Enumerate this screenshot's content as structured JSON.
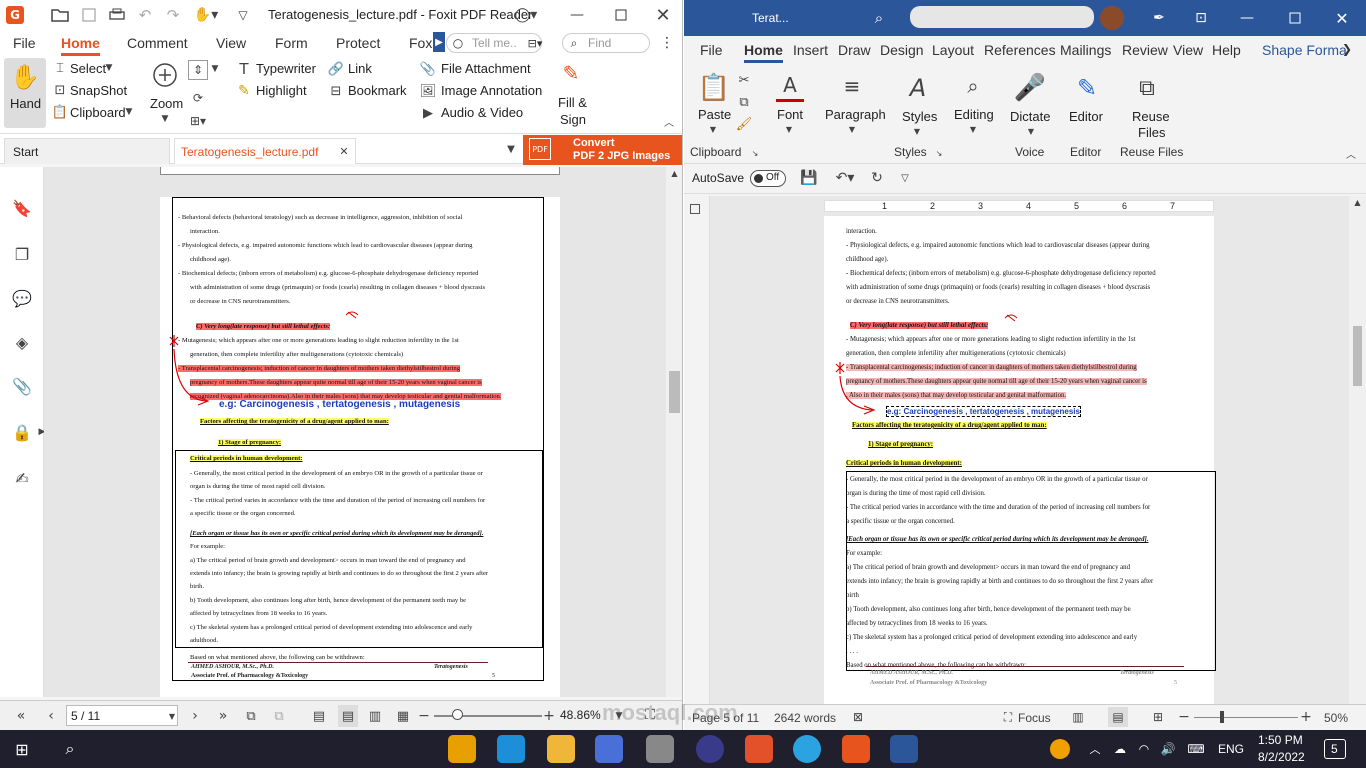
{
  "foxit": {
    "title": "Teratogenesis_lecture.pdf - Foxit PDF Reader",
    "menu": [
      "File",
      "Home",
      "Comment",
      "View",
      "Form",
      "Protect",
      "Foxi"
    ],
    "search": {
      "tell_me": "Tell me..",
      "find": "Find"
    },
    "ribbon": {
      "hand": "Hand",
      "select": "Select",
      "snapshot": "SnapShot",
      "clipboard": "Clipboard",
      "zoom": "Zoom",
      "typewriter": "Typewriter",
      "highlight": "Highlight",
      "link": "Link",
      "bookmark": "Bookmark",
      "file_attachment": "File Attachment",
      "image_annotation": "Image Annotation",
      "audio_video": "Audio & Video",
      "fill_sign_1": "Fill &",
      "fill_sign_2": "Sign"
    },
    "tabs": {
      "start": "Start",
      "doc": "Teratogenesis_lecture.pdf"
    },
    "convert": {
      "line1": "Convert",
      "line2": "PDF 2 JPG Images"
    },
    "status": {
      "page": "5 / 11",
      "zoom": "48.86%"
    }
  },
  "pdf_page": {
    "lines": [
      "- Behavioral defects (behavioral teratology) such as decrease in intelligence, aggression, inhibition of social",
      "interaction.",
      "- Physiological defects, e.g. impaired autonomic functions which lead to cardiovascular diseases (appear during",
      "childhood age).",
      "- Biochemical defects; (inborn errors of metabolism) e.g. glucose-6-phosphate dehydrogenase deficiency reported",
      "with administration of some drugs (primaquin) or foods (cearls) resulting in collagen diseases + blood dyscrasis",
      "or decrease in CNS neurotransmitters.",
      "C) Very long(late response) but still lethal effects:",
      "- Mutagenesis; which appears after one or more generations leading to slight reduction infertility in the 1st",
      "generation, then complete infertility after multigenerations (cytotoxic chemicals)",
      "- Transplacental carcinogenesis; induction of cancer in daughters of mothers taken diethylstilbestrol during",
      "pregnancy of mothers.These daughters appear quite normal till age of their 15-20 years when vaginal cancer is",
      "recognized (vaginal adenocarcinoma).Also in their males (sons) that may develop testicular and genital malformation.",
      "Factors affecting the teratogenicity of a drug/agent applied to man:",
      "1) Stage of pregnancy:",
      "Critical periods in human development:",
      "- Generally, the most critical period in the development of an embryo OR in the growth of a particular tissue or",
      "organ is during the time of most rapid cell division.",
      "- The critical period varies in accordance with the time and duration of the period of increasing cell numbers for",
      "a specific tissue or the organ concerned.",
      "[Each organ or tissue has its own or specific critical period during which its development may be deranged].",
      "For example:",
      "a) The critical period of brain growth and development> occurs in man toward the end of pregnancy and",
      "extends into infancy; the brain is growing rapidly at birth and continues to do so throughout the first 2 years after",
      "birth.",
      "b) Tooth development, also continues long after birth, hence development of the permanent teeth may be",
      "affected by tetracyclines from 18 weeks to 16 years.",
      "c) The skeletal system has a prolonged critical period of development extending into adolescence and early",
      "adulthood.",
      "Based on what mentioned above, the following can be withdrawn:"
    ],
    "annotation": "e.g: Carcinogenesis , tertatogenesis , mutagenesis",
    "footer_author": "AHMED ASHOUR, M.Sc., Ph.D.",
    "footer_role": "Associate Prof. of Pharmacology &Toxicology",
    "footer_title": "Teratogenesis",
    "footer_page": "5"
  },
  "word": {
    "title": "Terat...",
    "menu": [
      "File",
      "Home",
      "Insert",
      "Draw",
      "Design",
      "Layout",
      "References",
      "Mailings",
      "Review",
      "View",
      "Help",
      "Shape Forma"
    ],
    "ribbon": {
      "paste": "Paste",
      "clipboard": "Clipboard",
      "font": "Font",
      "paragraph": "Paragraph",
      "styles": "Styles",
      "styles_group": "Styles",
      "editing": "Editing",
      "dictate": "Dictate",
      "voice": "Voice",
      "editor": "Editor",
      "editor_group": "Editor",
      "reuse_1": "Reuse",
      "reuse_2": "Files",
      "reuse_group": "Reuse Files"
    },
    "autosave": "AutoSave",
    "autosave_state": "Off",
    "ruler_numbers": [
      "1",
      "2",
      "3",
      "4",
      "5",
      "6",
      "7"
    ],
    "status": {
      "page": "Page 5 of 11",
      "words": "2642 words",
      "focus": "Focus",
      "zoom": "50%"
    }
  },
  "word_page": {
    "lines": [
      "interaction.",
      "- Physiological defects, e.g. impaired autonomic functions which lead to cardiovascular diseases (appear during",
      "childhood age).",
      "- Biochemical defects; (inborn errors of metabolism) e.g. glucose-6-phosphate dehydrogenase deficiency reported",
      "with administration of some drugs (primaquin) or foods (cearls) resulting in collagen diseases + blood dyscrasis",
      "or decrease in CNS neurotransmitters.",
      "C) Very long(late response) but still lethal effects:",
      "- Mutagenesis; which appears after one or more generations leading to slight reduction infertility in the 1st",
      "generation, then complete infertility after multigenerations (cytotoxic chemicals)",
      "- Transplacental carcinogenesis; induction of cancer in daughters of mothers taken diethylstilbestrol during",
      "pregnancy of mothers.These daughters appear quite normal till age of their 15-20 years when vaginal cancer is",
      ". Also in their males (sons) that may develop testicular and genital malformation.",
      "e.g: Carcinogenesis , tertatogenesis , mutagenesis",
      "Factors affecting the teratogenicity of a drug/agent applied to man:",
      "1) Stage of pregnancy:",
      "Critical periods in human development:",
      "- Generally, the most critical period in the development of an embryo OR in the growth of a particular tissue or",
      "organ is during the time of most rapid cell division.",
      "- The critical period varies in accordance with the time and duration of the period of increasing cell numbers for",
      "a specific tissue or the organ concerned.",
      "[Each organ or tissue has its own or specific critical period during which its development may be deranged].",
      "For example:",
      "a) The critical period of brain growth and development> occurs in man toward the end of pregnancy and",
      "extends into infancy; the brain is growing rapidly at birth and continues to do so throughout the first 2 years after",
      "birth",
      "b) Tooth development, also continues long after birth, hence development of the permanent teeth may be",
      "affected by tetracyclines from 18 weeks to 16 years.",
      "c) The skeletal system has a prolonged critical period of development extending into adolescence and early",
      ". . . .",
      "Based on what mentioned above, the following can be withdrawn:"
    ],
    "footer_author": "AHMED ASHOUR, M.Sc., Ph.D.",
    "footer_role": "Associate Prof. of Pharmacology &Toxicology",
    "footer_title": "Teratogenesis",
    "footer_page": "5"
  },
  "taskbar": {
    "time": "1:50 PM",
    "date": "8/2/2022",
    "lang": "ENG",
    "notif": "5"
  },
  "watermark": {
    "text": "mostaql.com"
  }
}
